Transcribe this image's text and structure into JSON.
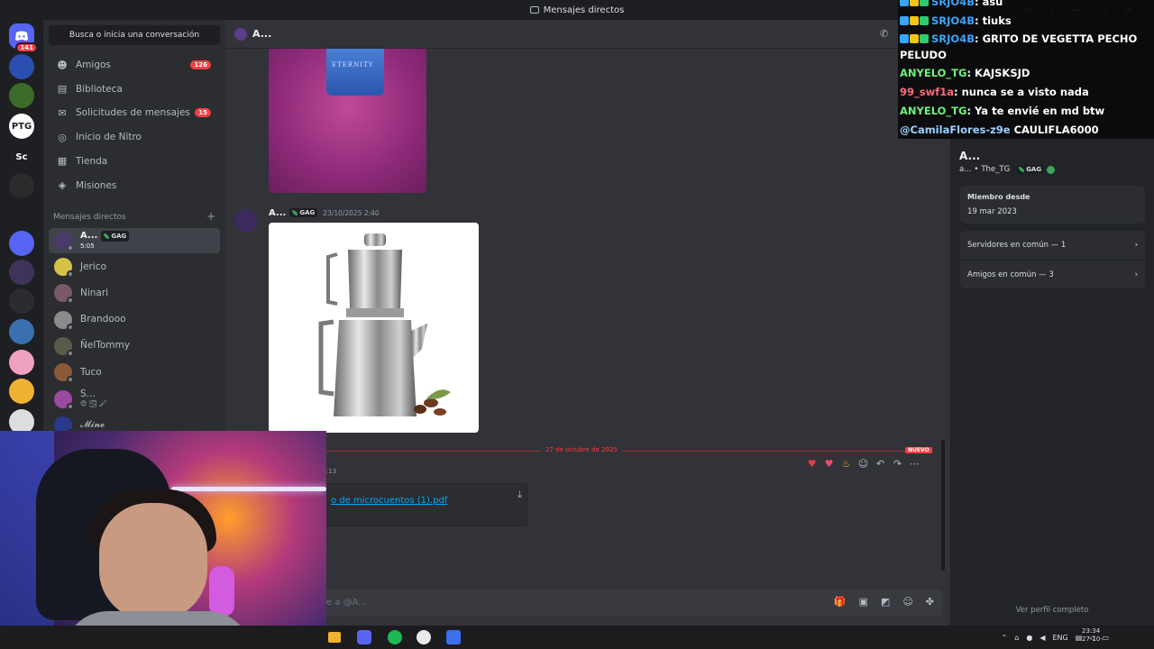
{
  "window": {
    "title": "Mensajes directos"
  },
  "servers": {
    "home_badge": "141",
    "items": [
      {
        "label": "",
        "color": "#2a4fb0"
      },
      {
        "label": "",
        "color": "#3a6b2a"
      },
      {
        "label": "PTG",
        "color": "#ffffff"
      },
      {
        "label": "Sc",
        "color": "#1e1f22"
      },
      {
        "label": "",
        "color": "#2b2b2b"
      },
      {
        "label": "",
        "color": "#1e1f22"
      },
      {
        "label": "",
        "color": "#5865f2"
      },
      {
        "label": "",
        "color": "#40335a",
        "badge": "1"
      },
      {
        "label": "",
        "color": "#2d2a30"
      },
      {
        "label": "",
        "color": "#3a6fb0"
      },
      {
        "label": "",
        "color": "#f0a0c0"
      },
      {
        "label": "",
        "color": "#f0b232"
      },
      {
        "label": "",
        "color": "#dddddd",
        "badge": "8"
      }
    ]
  },
  "sidebar": {
    "search_placeholder": "Busca o inicia una conversación",
    "nav": [
      {
        "label": "Amigos",
        "badge": "126",
        "icon": "friends-icon"
      },
      {
        "label": "Biblioteca",
        "badge": "",
        "icon": "library-icon"
      },
      {
        "label": "Solicitudes de mensajes",
        "badge": "15",
        "icon": "envelope-icon"
      },
      {
        "label": "Inicio de Nitro",
        "badge": "",
        "icon": "nitro-icon"
      },
      {
        "label": "Tienda",
        "badge": "",
        "icon": "shop-icon"
      },
      {
        "label": "Misiones",
        "badge": "",
        "icon": "quest-icon"
      }
    ],
    "dm_header": "Mensajes directos",
    "dm_add": "+",
    "active_dm": {
      "name": "A...",
      "tag": "GAG",
      "status": "5:05"
    },
    "dms": [
      {
        "name": "Jerico",
        "color": "#d4c24a"
      },
      {
        "name": "Ninari",
        "color": "#7a5a6a"
      },
      {
        "name": "Brandooo",
        "color": "#8a8a8a"
      },
      {
        "name": "ÑelTommy",
        "color": "#5a5a4a"
      },
      {
        "name": "Tuco",
        "color": "#8a5a3a"
      },
      {
        "name": "S...",
        "color": "#9a4aa0",
        "status": "😊 🌫 🖌"
      },
      {
        "name": "𝓜𝓲𝓷𝓮",
        "color": "#2a3a8a"
      }
    ]
  },
  "chat": {
    "header_name": "A...",
    "image1_text": "ETERNITY",
    "message": {
      "author": "A...",
      "tag": "GAG",
      "timestamp": "23/10/2025 2:40"
    },
    "divider_label": "27 de octubre de 2025",
    "new_label": "NUEVO",
    "msg3_time": ":13",
    "attachment_name": "o de microcuentos (1).pdf",
    "composer_placeholder": "e a @A..."
  },
  "profile": {
    "name": "A...",
    "sub_user": "a...",
    "sub_tag": "The_TG",
    "sub_badge": "GAG",
    "member_since_label": "Miembro desde",
    "member_since_value": "19 mar 2023",
    "mutual_servers": "Servidores en común — 1",
    "mutual_friends": "Amigos en común — 3",
    "full_profile": "Ver perfil completo"
  },
  "stream_chat": [
    {
      "user": "SRJO4B",
      "text": ": asu",
      "cls": "u1"
    },
    {
      "user": "SRJO4B",
      "text": ": tiuks",
      "cls": "u1"
    },
    {
      "user": "SRJO4B",
      "text": ": GRITO DE VEGETTA PECHO",
      "cls": "u1"
    },
    {
      "user": "",
      "text": "PELUDO",
      "cls": "u1"
    },
    {
      "user": "ANYELO_TG",
      "text": ": KAJSKSJD",
      "cls": "u2"
    },
    {
      "user": "99_swf1a",
      "text": ": nunca se a visto nada",
      "cls": "u3"
    },
    {
      "user": "ANYELO_TG",
      "text": ": Ya te envié en md btw",
      "cls": "u2"
    },
    {
      "user": "@CamilaFlores-z9e",
      "text": " CAULIFLA6000",
      "cls": "u4"
    }
  ],
  "taskbar": {
    "lang": "ENG",
    "time": "23:34",
    "date": "27-10-"
  },
  "colors": {
    "accent": "#5865f2",
    "danger": "#f23f43",
    "online": "#3ba55d",
    "link": "#00a8fc"
  }
}
